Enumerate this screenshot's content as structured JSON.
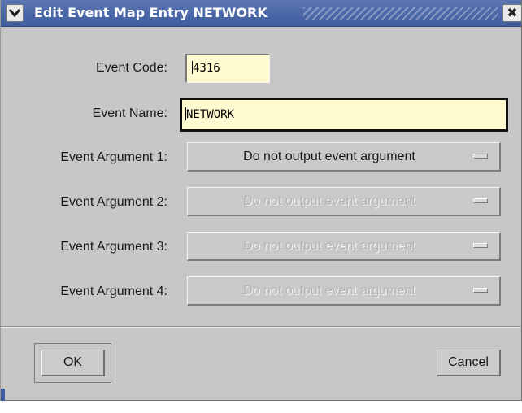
{
  "window": {
    "title": "Edit Event Map Entry NETWORK",
    "close_glyph": "✖",
    "menu_glyph": "▼"
  },
  "form": {
    "code_label": "Event Code:",
    "code_value": "4316",
    "name_label": "Event Name:",
    "name_value": "NETWORK",
    "arguments": [
      {
        "label": "Event Argument 1:",
        "value": "Do not output event argument",
        "enabled": true
      },
      {
        "label": "Event Argument 2:",
        "value": "Do not output event argument",
        "enabled": false
      },
      {
        "label": "Event Argument 3:",
        "value": "Do not output event argument",
        "enabled": false
      },
      {
        "label": "Event Argument 4:",
        "value": "Do not output event argument",
        "enabled": false
      }
    ]
  },
  "buttons": {
    "ok": "OK",
    "cancel": "Cancel"
  },
  "colors": {
    "titlebar": "#3f5c9e",
    "background": "#c7c7c7",
    "field_bg": "#fff9cf"
  }
}
